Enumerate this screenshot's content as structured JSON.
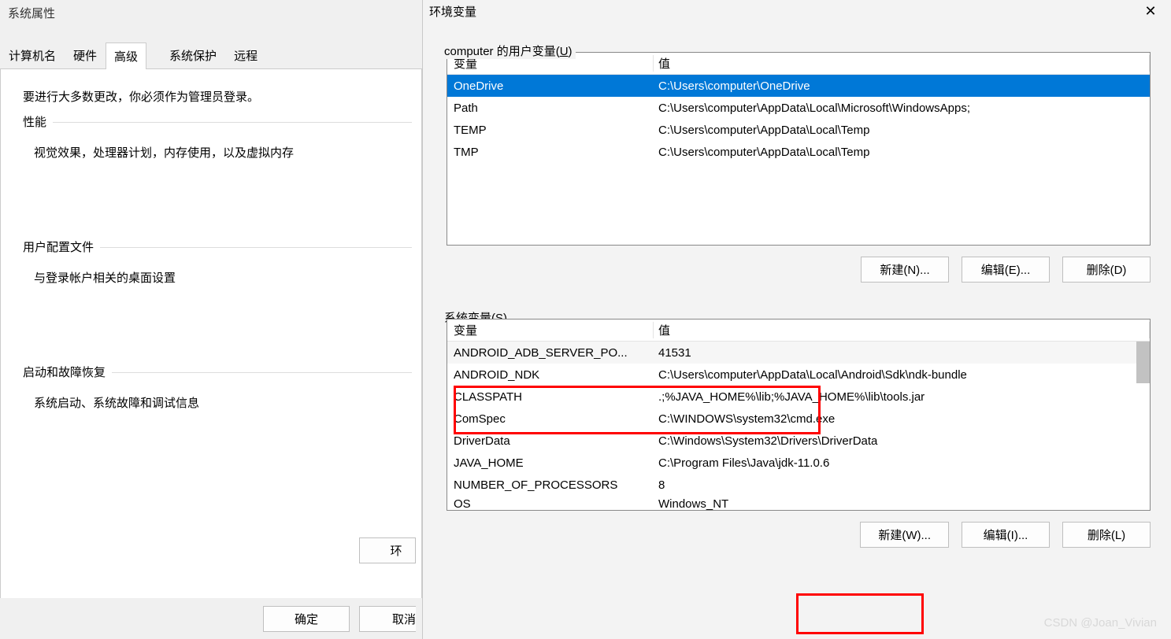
{
  "sysprop": {
    "title": "系统属性",
    "tabs": [
      "计算机名",
      "硬件",
      "高级",
      "系统保护",
      "远程"
    ],
    "active_tab": "高级",
    "intro": "要进行大多数更改，你必须作为管理员登录。",
    "groups": {
      "perf": {
        "title": "性能",
        "desc": "视觉效果，处理器计划，内存使用，以及虚拟内存"
      },
      "prof": {
        "title": "用户配置文件",
        "desc": "与登录帐户相关的桌面设置"
      },
      "boot": {
        "title": "启动和故障恢复",
        "desc": "系统启动、系统故障和调试信息"
      }
    },
    "envbtn_partial": "环",
    "ok": "确定",
    "cancel": "取消"
  },
  "env": {
    "title": "环境变量",
    "user_label_pre": "computer 的用户变量(",
    "user_label_u": "U",
    "user_label_post": ")",
    "sys_label_pre": "系统变量(",
    "sys_label_u": "S",
    "sys_label_post": ")",
    "col_var": "变量",
    "col_val": "值",
    "user_rows": [
      {
        "var": "OneDrive",
        "val": "C:\\Users\\computer\\OneDrive"
      },
      {
        "var": "Path",
        "val": "C:\\Users\\computer\\AppData\\Local\\Microsoft\\WindowsApps;"
      },
      {
        "var": "TEMP",
        "val": "C:\\Users\\computer\\AppData\\Local\\Temp"
      },
      {
        "var": "TMP",
        "val": "C:\\Users\\computer\\AppData\\Local\\Temp"
      }
    ],
    "sys_rows": [
      {
        "var": "ANDROID_ADB_SERVER_PO...",
        "val": "41531"
      },
      {
        "var": "ANDROID_NDK",
        "val": "C:\\Users\\computer\\AppData\\Local\\Android\\Sdk\\ndk-bundle"
      },
      {
        "var": "CLASSPATH",
        "val": ".;%JAVA_HOME%\\lib;%JAVA_HOME%\\lib\\tools.jar"
      },
      {
        "var": "ComSpec",
        "val": "C:\\WINDOWS\\system32\\cmd.exe"
      },
      {
        "var": "DriverData",
        "val": "C:\\Windows\\System32\\Drivers\\DriverData"
      },
      {
        "var": "JAVA_HOME",
        "val": "C:\\Program Files\\Java\\jdk-11.0.6"
      },
      {
        "var": "NUMBER_OF_PROCESSORS",
        "val": "8"
      },
      {
        "var": "OS",
        "val": "Windows_NT"
      }
    ],
    "btn_new_n": "新建(N)...",
    "btn_edit_e": "编辑(E)...",
    "btn_del_d": "删除(D)",
    "btn_new_w": "新建(W)...",
    "btn_edit_i": "编辑(I)...",
    "btn_del_l": "删除(L)"
  },
  "watermark": "CSDN @Joan_Vivian"
}
